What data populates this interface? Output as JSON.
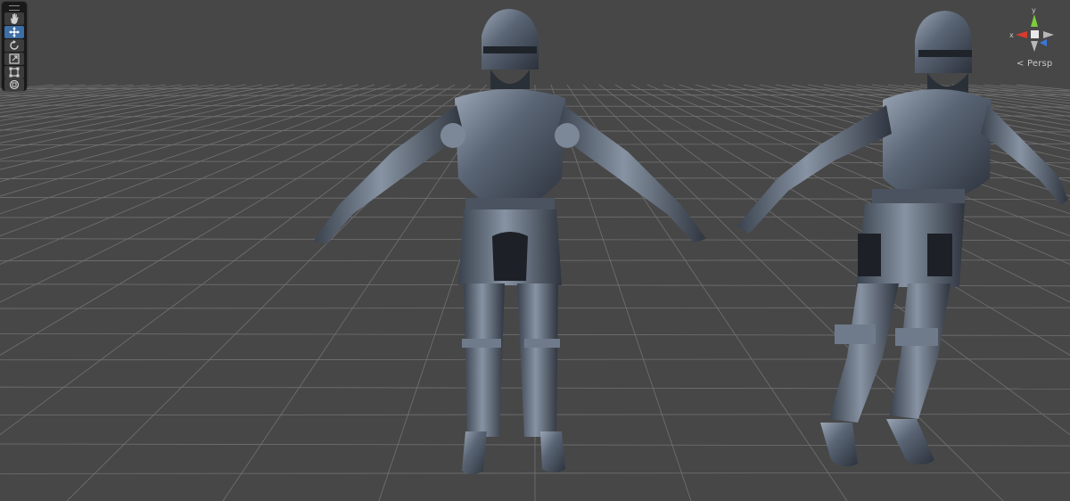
{
  "scene_view": {
    "toolbar": {
      "tools": [
        {
          "id": "hand",
          "icon": "hand-icon",
          "active": false
        },
        {
          "id": "move",
          "icon": "move-icon",
          "active": true
        },
        {
          "id": "rotate",
          "icon": "rotate-icon",
          "active": false
        },
        {
          "id": "scale",
          "icon": "scale-icon",
          "active": false
        },
        {
          "id": "rect",
          "icon": "rect-transform-icon",
          "active": false
        },
        {
          "id": "transform",
          "icon": "transform-icon",
          "active": false
        }
      ]
    },
    "gizmo": {
      "x_label": "x",
      "y_label": "y",
      "colors": {
        "x": "#d83a2e",
        "y": "#7bd03a",
        "z": "#3a78d8"
      },
      "projection_label": "Persp"
    },
    "models": [
      {
        "name": "knight-armor-front",
        "icon": "armor-model"
      },
      {
        "name": "knight-armor-angled",
        "icon": "armor-model"
      }
    ],
    "colors": {
      "background": "#474747",
      "grid_line": "#8a8a8a",
      "armor": "#5c6878"
    }
  }
}
